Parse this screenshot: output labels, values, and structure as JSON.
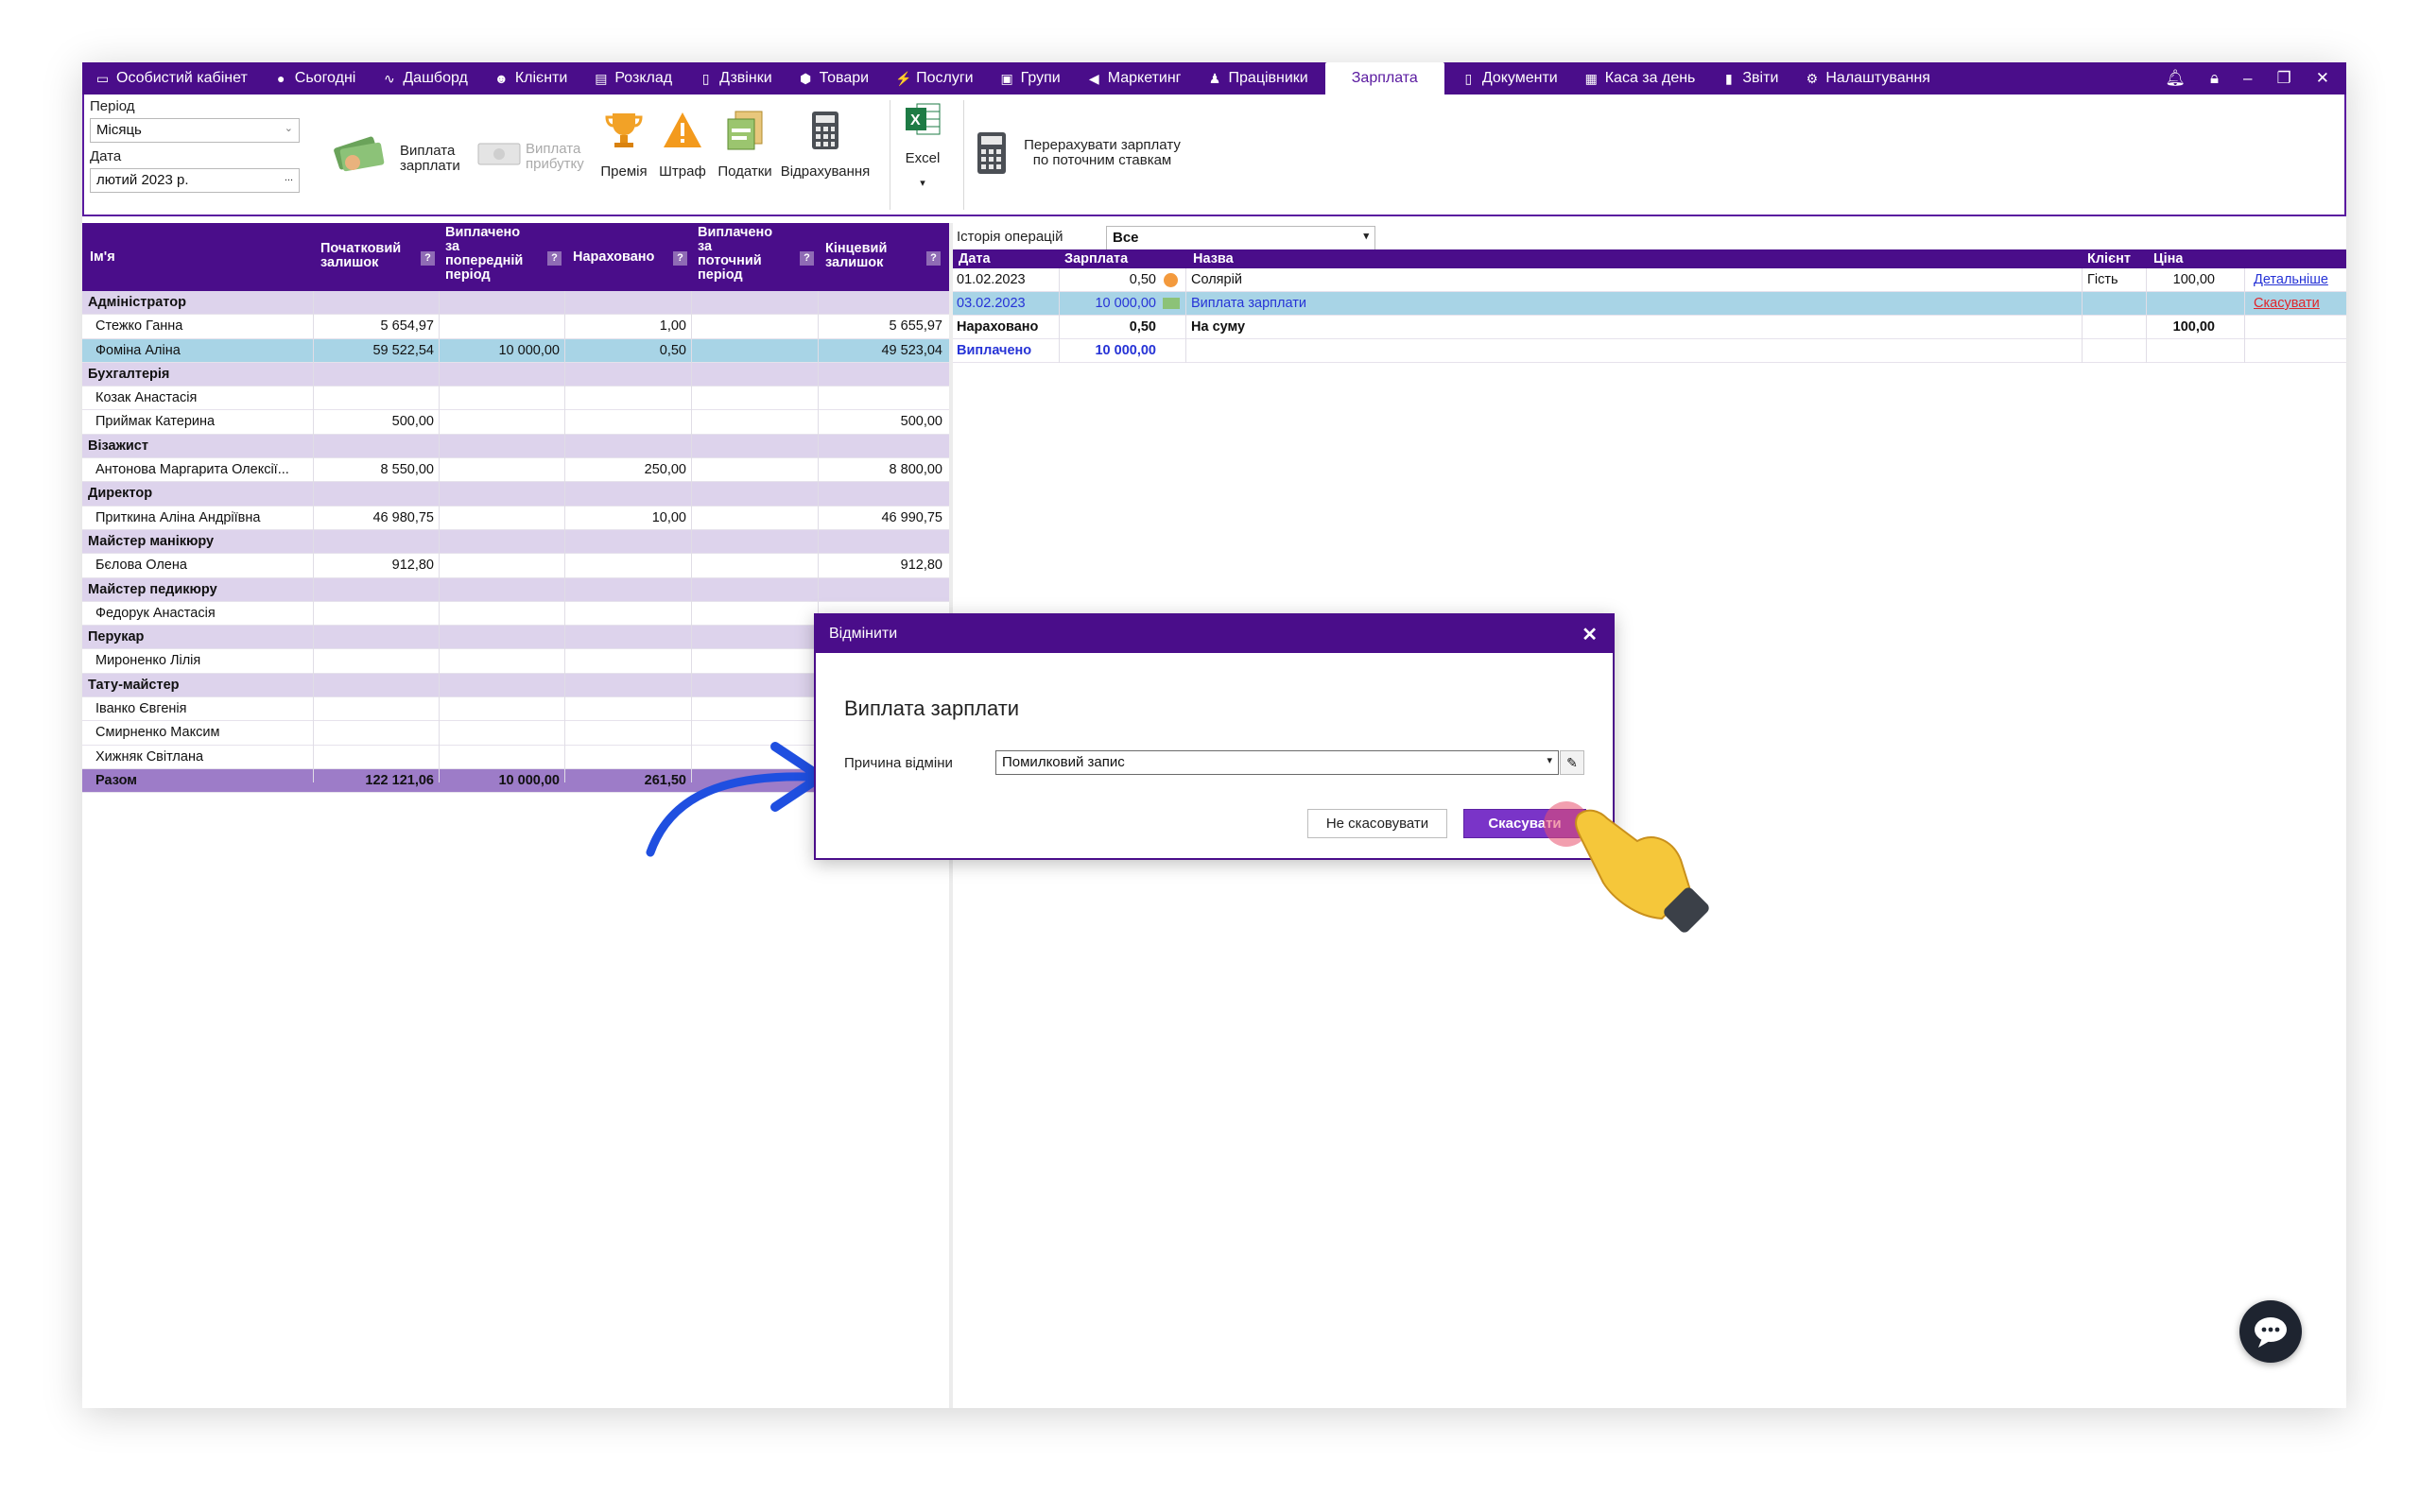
{
  "nav": {
    "tabs": [
      "Особистий кабінет",
      "Сьогодні",
      "Дашборд",
      "Клієнти",
      "Розклад",
      "Дзвінки",
      "Товари",
      "Послуги",
      "Групи",
      "Маркетинг",
      "Працівники",
      "Зарплата",
      "Документи",
      "Каса за день",
      "Звіти",
      "Налаштування"
    ],
    "active_tab": "Зарплата"
  },
  "ribbon": {
    "period_label": "Період",
    "period_value": "Місяць",
    "date_label": "Дата",
    "date_value": "лютий 2023 р.",
    "date_btn": "...",
    "pay_salary": [
      "Виплата",
      "зарплати"
    ],
    "pay_profit": [
      "Виплата",
      "прибутку"
    ],
    "bonus": "Премія",
    "fine": "Штраф",
    "taxes": "Податки",
    "deductions": "Відрахування",
    "excel": "Excel",
    "recalc": [
      "Перерахувати зарплату",
      "по поточним ставкам"
    ]
  },
  "left_table": {
    "headers": {
      "name": "Ім'я",
      "opening": [
        "Початковий",
        "залишок"
      ],
      "paid_prev": [
        "Виплачено",
        "за",
        "попередній",
        "період"
      ],
      "accrued": "Нараховано",
      "paid_cur": [
        "Виплачено",
        "за",
        "поточний",
        "період"
      ],
      "closing": [
        "Кінцевий",
        "залишок"
      ],
      "help": "?"
    },
    "rows": [
      {
        "type": "group",
        "name": "Адміністратор"
      },
      {
        "type": "row",
        "name": "Стежко Ганна",
        "opening": "5 654,97",
        "paid_prev": "",
        "accrued": "1,00",
        "paid_cur": "",
        "closing": "5 655,97"
      },
      {
        "type": "sel",
        "name": "Фоміна Аліна",
        "opening": "59 522,54",
        "paid_prev": "10 000,00",
        "accrued": "0,50",
        "paid_cur": "",
        "closing": "49 523,04"
      },
      {
        "type": "group",
        "name": "Бухгалтерія"
      },
      {
        "type": "row",
        "name": "Козак Анастасія",
        "opening": "",
        "paid_prev": "",
        "accrued": "",
        "paid_cur": "",
        "closing": ""
      },
      {
        "type": "row",
        "name": "Приймак Катерина",
        "opening": "500,00",
        "paid_prev": "",
        "accrued": "",
        "paid_cur": "",
        "closing": "500,00"
      },
      {
        "type": "group",
        "name": "Візажист"
      },
      {
        "type": "row",
        "name": "Антонова Маргарита Олексії...",
        "opening": "8 550,00",
        "paid_prev": "",
        "accrued": "250,00",
        "paid_cur": "",
        "closing": "8 800,00"
      },
      {
        "type": "group",
        "name": "Директор"
      },
      {
        "type": "row",
        "name": "Приткина Аліна Андріївна",
        "opening": "46 980,75",
        "paid_prev": "",
        "accrued": "10,00",
        "paid_cur": "",
        "closing": "46 990,75"
      },
      {
        "type": "group",
        "name": "Майстер манікюру"
      },
      {
        "type": "row",
        "name": "Бєлова Олена",
        "opening": "912,80",
        "paid_prev": "",
        "accrued": "",
        "paid_cur": "",
        "closing": "912,80"
      },
      {
        "type": "group",
        "name": "Майстер педикюру"
      },
      {
        "type": "row",
        "name": "Федорук Анастасія",
        "opening": "",
        "paid_prev": "",
        "accrued": "",
        "paid_cur": "",
        "closing": ""
      },
      {
        "type": "group",
        "name": "Перукар"
      },
      {
        "type": "row",
        "name": "Мироненко Лілія",
        "opening": "",
        "paid_prev": "",
        "accrued": "",
        "paid_cur": "",
        "closing": ""
      },
      {
        "type": "group",
        "name": "Тату-майстер"
      },
      {
        "type": "row",
        "name": "Іванко Євгенія",
        "opening": "",
        "paid_prev": "",
        "accrued": "",
        "paid_cur": "",
        "closing": ""
      },
      {
        "type": "row",
        "name": "Смирненко Максим",
        "opening": "",
        "paid_prev": "",
        "accrued": "",
        "paid_cur": "",
        "closing": ""
      },
      {
        "type": "row",
        "name": "Хижняк Світлана",
        "opening": "",
        "paid_prev": "",
        "accrued": "",
        "paid_cur": "",
        "closing": ""
      },
      {
        "type": "total",
        "name": "Разом",
        "opening": "122 121,06",
        "paid_prev": "10 000,00",
        "accrued": "261,50",
        "paid_cur": "",
        "closing": ""
      }
    ]
  },
  "right_panel": {
    "history_label": "Історія операцій",
    "history_value": "Все",
    "headers": {
      "date": "Дата",
      "salary": "Зарплата",
      "title": "Назва",
      "client": "Клієнт",
      "price": "Ціна"
    },
    "rows": [
      {
        "date": "01.02.2023",
        "salary": "0,50",
        "title": "Солярій",
        "client": "Гість",
        "price": "100,00",
        "link": "Детальніше"
      },
      {
        "date": "03.02.2023",
        "salary": "10 000,00",
        "title": "Виплата зарплати",
        "client": "",
        "price": "",
        "link": "Скасувати"
      }
    ],
    "accrued_label": "Нараховано",
    "accrued_value": "0,50",
    "sum_label": "На суму",
    "sum_value": "100,00",
    "paid_label": "Виплачено",
    "paid_value": "10 000,00"
  },
  "dialog": {
    "title": "Відмінити",
    "heading": "Виплата зарплати",
    "reason_label": "Причина відміни",
    "reason_value": "Помилковий запис",
    "no_cancel_btn": "Не скасовувати",
    "cancel_btn": "Скасувати"
  },
  "colors": {
    "brand": "#4a0d8a",
    "group_row": "#ddd3ec",
    "selected_row": "#a8d4e6",
    "total_row": "#9d7cc8",
    "arrow": "#1f4fe0",
    "cancel_link": "#e0262b"
  },
  "icons": [
    "cabinet-icon",
    "today-icon",
    "dashboard-icon",
    "clients-icon",
    "schedule-icon",
    "calls-icon",
    "goods-icon",
    "services-icon",
    "groups-icon",
    "marketing-icon",
    "staff-icon",
    "documents-icon",
    "cashbox-icon",
    "reports-icon",
    "settings-icon",
    "bell-icon",
    "lock-icon",
    "chat-icon",
    "hand-pointer-icon",
    "arrow-icon",
    "pencil-icon"
  ]
}
